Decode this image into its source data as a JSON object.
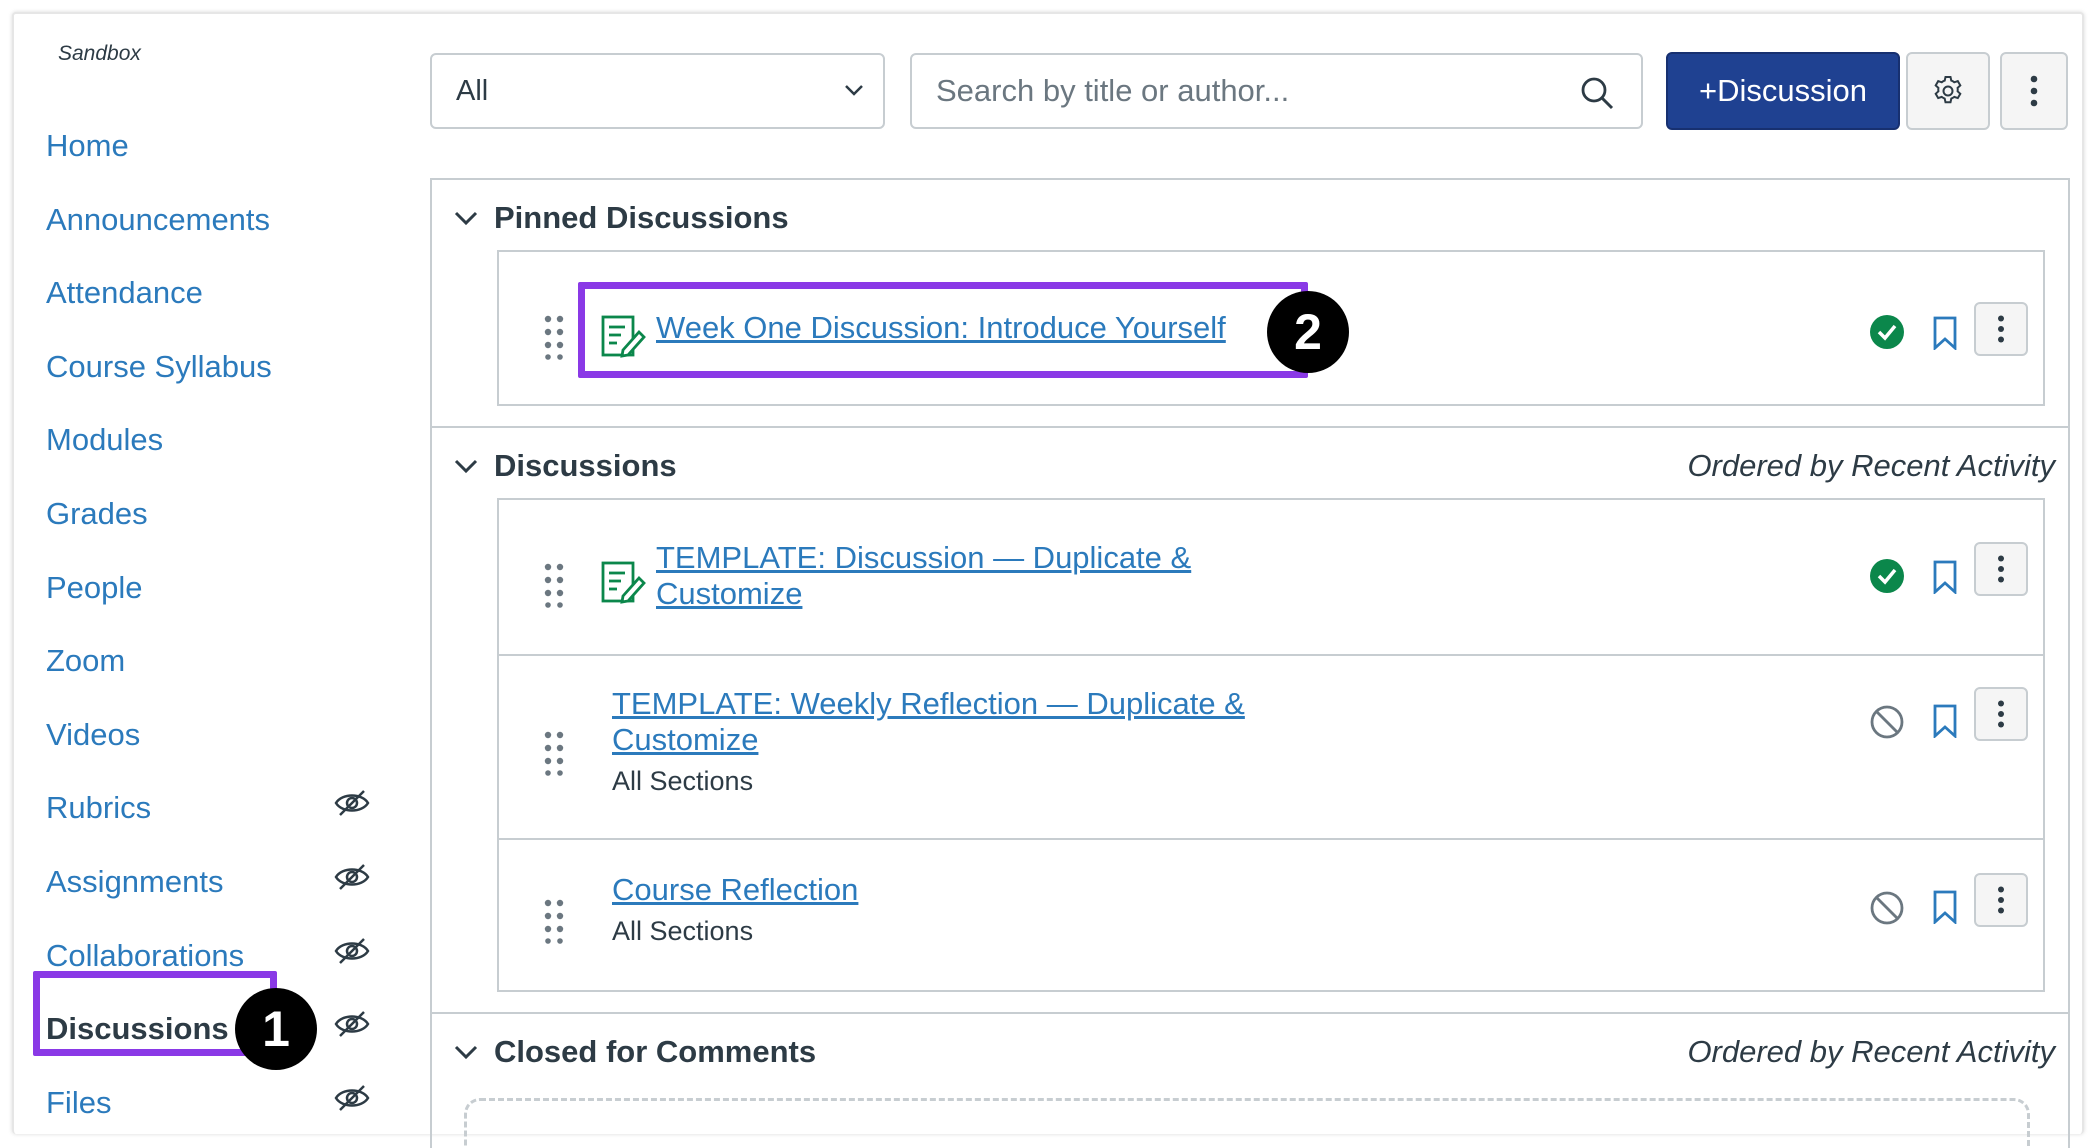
{
  "sidebar": {
    "course_name": "Sandbox",
    "items": [
      {
        "label": "Home",
        "hidden": false,
        "active": false
      },
      {
        "label": "Announcements",
        "hidden": false,
        "active": false
      },
      {
        "label": "Attendance",
        "hidden": false,
        "active": false
      },
      {
        "label": "Course Syllabus",
        "hidden": false,
        "active": false
      },
      {
        "label": "Modules",
        "hidden": false,
        "active": false
      },
      {
        "label": "Grades",
        "hidden": false,
        "active": false
      },
      {
        "label": "People",
        "hidden": false,
        "active": false
      },
      {
        "label": "Zoom",
        "hidden": false,
        "active": false
      },
      {
        "label": "Videos",
        "hidden": false,
        "active": false
      },
      {
        "label": "Rubrics",
        "hidden": true,
        "active": false
      },
      {
        "label": "Assignments",
        "hidden": true,
        "active": false
      },
      {
        "label": "Collaborations",
        "hidden": true,
        "active": false
      },
      {
        "label": "Discussions",
        "hidden": true,
        "active": true
      },
      {
        "label": "Files",
        "hidden": true,
        "active": false
      }
    ],
    "hidden_icon": "eye-slash-icon"
  },
  "toolbar": {
    "filter_value": "All",
    "search_placeholder": "Search by title or author...",
    "add_discussion_label": "+Discussion",
    "settings_icon": "gear-icon",
    "more_icon": "kebab-icon"
  },
  "sections": {
    "pinned": {
      "title": "Pinned Discussions",
      "items": [
        {
          "title": "Week One Discussion: Introduce Yourself",
          "graded": true,
          "published": true,
          "sub": ""
        }
      ]
    },
    "discussions": {
      "title": "Discussions",
      "order_label": "Ordered by Recent Activity",
      "items": [
        {
          "title_line1": "TEMPLATE: Discussion — Duplicate &",
          "title_line2": "Customize",
          "graded": true,
          "published": true,
          "sub": ""
        },
        {
          "title_line1": "TEMPLATE: Weekly Reflection — Duplicate &",
          "title_line2": "Customize",
          "graded": false,
          "published": false,
          "sub": "All Sections"
        },
        {
          "title_line1": "Course Reflection",
          "title_line2": "",
          "graded": false,
          "published": false,
          "sub": "All Sections"
        }
      ]
    },
    "closed": {
      "title": "Closed for Comments",
      "order_label": "Ordered by Recent Activity"
    }
  },
  "callouts": {
    "one": "1",
    "two": "2"
  },
  "colors": {
    "link": "#2b7abc",
    "primary_button": "#1f4191",
    "published_green": "#0b874b",
    "callout_purple": "#8a39e6",
    "graded_icon_green": "#0b874b"
  }
}
